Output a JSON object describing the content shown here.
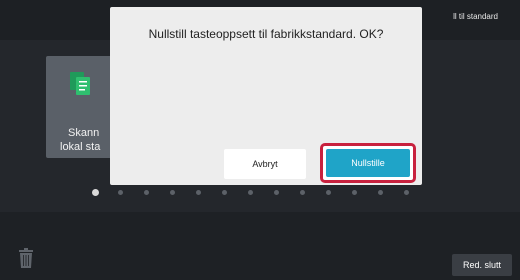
{
  "background": {
    "top_right_text": "ll til standard",
    "tile_label_line1": "Skann",
    "tile_label_line2": "lokal sta",
    "pagination": {
      "count": 13,
      "active_index": 0
    },
    "footer_button": "Red. slutt"
  },
  "dialog": {
    "message": "Nullstill tasteoppsett til fabrikkstandard. OK?",
    "cancel_label": "Avbryt",
    "confirm_label": "Nullstille"
  },
  "colors": {
    "confirm_button": "#1fa4c8",
    "highlight_border": "#c8213e",
    "icon_green": "#1f9a5a"
  }
}
